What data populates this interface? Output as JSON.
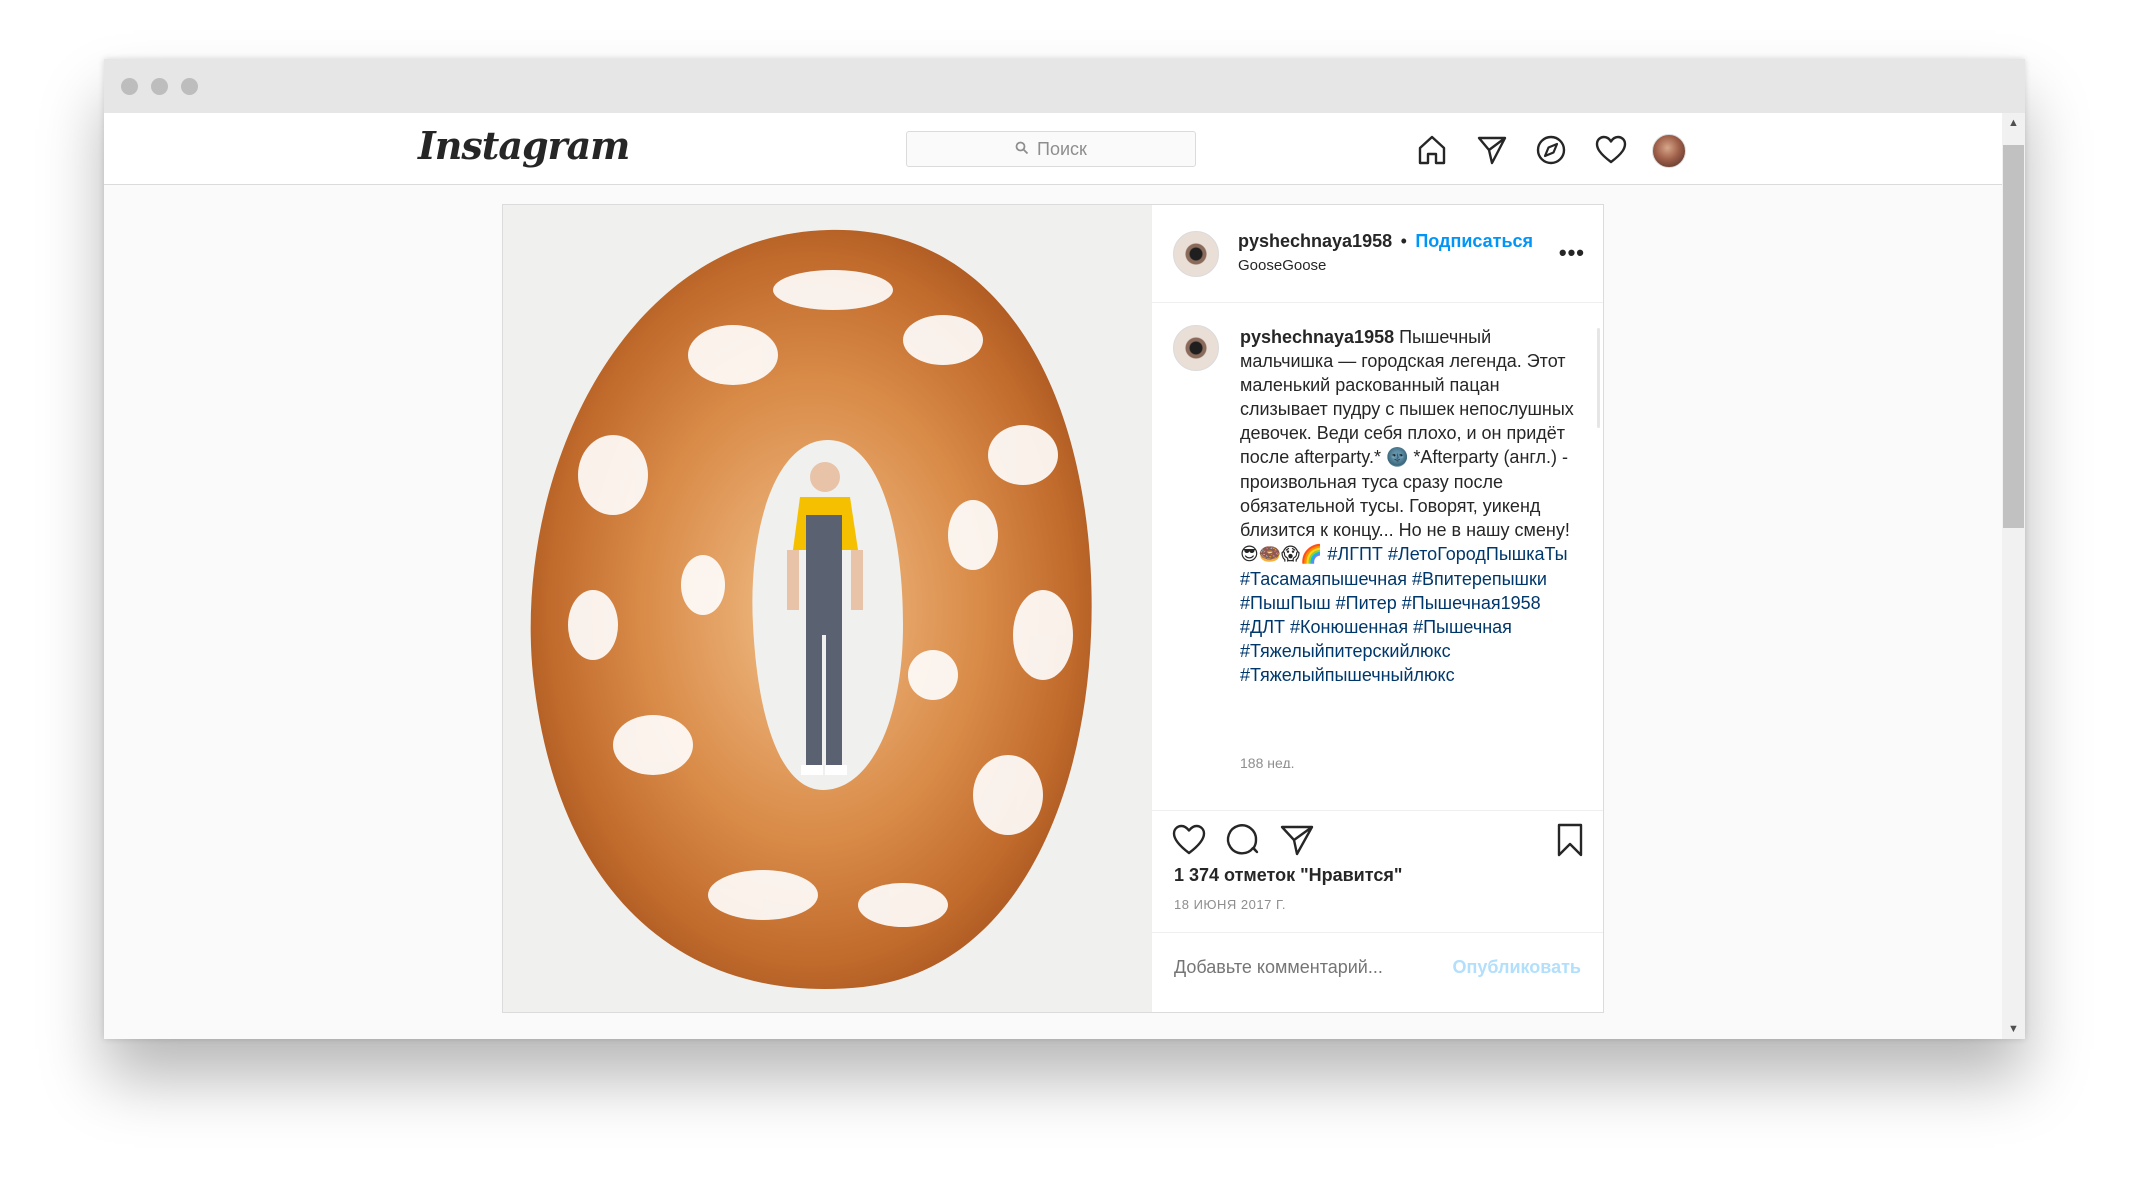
{
  "nav": {
    "logo": "Instagram",
    "search_placeholder": "Поиск",
    "icons": [
      "home-icon",
      "direct-icon",
      "explore-icon",
      "activity-icon",
      "profile-avatar"
    ]
  },
  "post": {
    "username": "pyshechnaya1958",
    "separator": "•",
    "follow_label": "Подписаться",
    "location": "GooseGoose",
    "more_label": "•••",
    "caption_segments": [
      {
        "type": "user",
        "text": "pyshechnaya1958"
      },
      {
        "type": "text",
        "text": " Пышечный мальчишка — городская легенда. Этот маленький раскованный пацан слизывает пудру с пышек непослушных девочек. Веди себя плохо, и он придёт после afterparty.* "
      },
      {
        "type": "emoji",
        "text": "🌚"
      },
      {
        "type": "text",
        "text": " *Afterparty (англ.) - произвольная туса сразу после обязательной тусы. Говорят, уикенд близится к концу... Но не в нашу смену! "
      },
      {
        "type": "emoji",
        "text": "😎🍩😱🌈"
      },
      {
        "type": "text",
        "text": " "
      },
      {
        "type": "tag",
        "text": "#ЛГПТ"
      },
      {
        "type": "text",
        "text": " "
      },
      {
        "type": "tag",
        "text": "#ЛетоГородПышкаТы"
      },
      {
        "type": "text",
        "text": " "
      },
      {
        "type": "tag",
        "text": "#Тасамаяпышечная"
      },
      {
        "type": "text",
        "text": " "
      },
      {
        "type": "tag",
        "text": "#Впитерепышки"
      },
      {
        "type": "text",
        "text": " "
      },
      {
        "type": "tag",
        "text": "#ПышПыш"
      },
      {
        "type": "text",
        "text": " "
      },
      {
        "type": "tag",
        "text": "#Питер"
      },
      {
        "type": "text",
        "text": " "
      },
      {
        "type": "tag",
        "text": "#Пышечная1958"
      },
      {
        "type": "text",
        "text": " "
      },
      {
        "type": "tag",
        "text": "#ДЛТ"
      },
      {
        "type": "text",
        "text": " "
      },
      {
        "type": "tag",
        "text": "#Конюшенная"
      },
      {
        "type": "text",
        "text": " "
      },
      {
        "type": "tag",
        "text": "#Пышечная"
      },
      {
        "type": "text",
        "text": " "
      },
      {
        "type": "tag",
        "text": "#Тяжелыйпитерскийлюкс"
      },
      {
        "type": "text",
        "text": " "
      },
      {
        "type": "tag",
        "text": "#Тяжелыйпышечныйлюкс"
      }
    ],
    "caption_age": "188 нед.",
    "likes": "1 374 отметок \"Нравится\"",
    "date": "18 ИЮНЯ 2017 Г.",
    "comment_placeholder": "Добавьте комментарий...",
    "publish_label": "Опубликовать"
  },
  "colors": {
    "accent": "#0095f6",
    "publish_disabled": "#b2dffc",
    "hashtag": "#00376b",
    "border": "#dbdbdb"
  }
}
